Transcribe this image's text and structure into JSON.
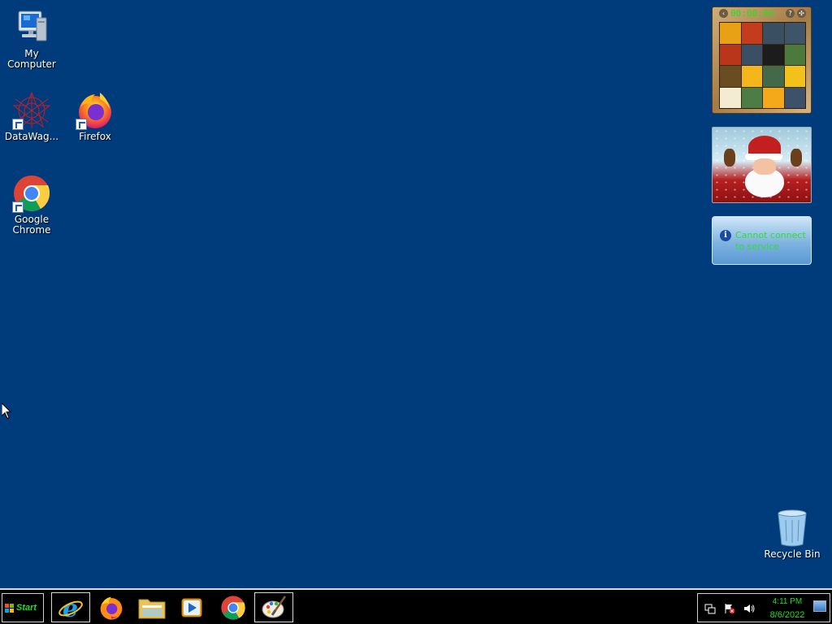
{
  "desktop": {
    "background_color": "#003c7c",
    "icons": [
      {
        "label": "My Computer",
        "icon": "computer-icon"
      },
      {
        "label": "DataWag...",
        "icon": "datawagon-icon"
      },
      {
        "label": "Firefox",
        "icon": "firefox-icon"
      },
      {
        "label": "Google Chrome",
        "icon": "chrome-icon"
      },
      {
        "label": "Recycle Bin",
        "icon": "recycle-bin-icon"
      }
    ]
  },
  "gadgets": {
    "puzzle": {
      "title": "00:00:00",
      "tile_colors": [
        "#e8a015",
        "#c53b1d",
        "#3b4f63",
        "#3e5569",
        "#b9361a",
        "#3a4f66",
        "#1c1c1c",
        "#4c7a3d",
        "#6a4c22",
        "#f4b61a",
        "#41694a",
        "#f2c21a",
        "#f3ecd3",
        "#4c7d46",
        "#f4a91b",
        "#3d526a"
      ]
    },
    "info": {
      "message": "Cannot connect to service"
    }
  },
  "taskbar": {
    "start_label": "Start",
    "apps": [
      {
        "name": "internet-explorer",
        "icon": "ie-icon",
        "active": true
      },
      {
        "name": "firefox",
        "icon": "firefox-icon",
        "active": false
      },
      {
        "name": "file-explorer",
        "icon": "folder-icon",
        "active": false
      },
      {
        "name": "media-player",
        "icon": "media-player-icon",
        "active": false
      },
      {
        "name": "chrome",
        "icon": "chrome-icon",
        "active": false
      },
      {
        "name": "paint",
        "icon": "paint-palette-icon",
        "active": true
      }
    ],
    "tray": {
      "time": "4:11 PM",
      "date": "8/6/2022"
    },
    "accent_text_color": "#1fe11f"
  }
}
